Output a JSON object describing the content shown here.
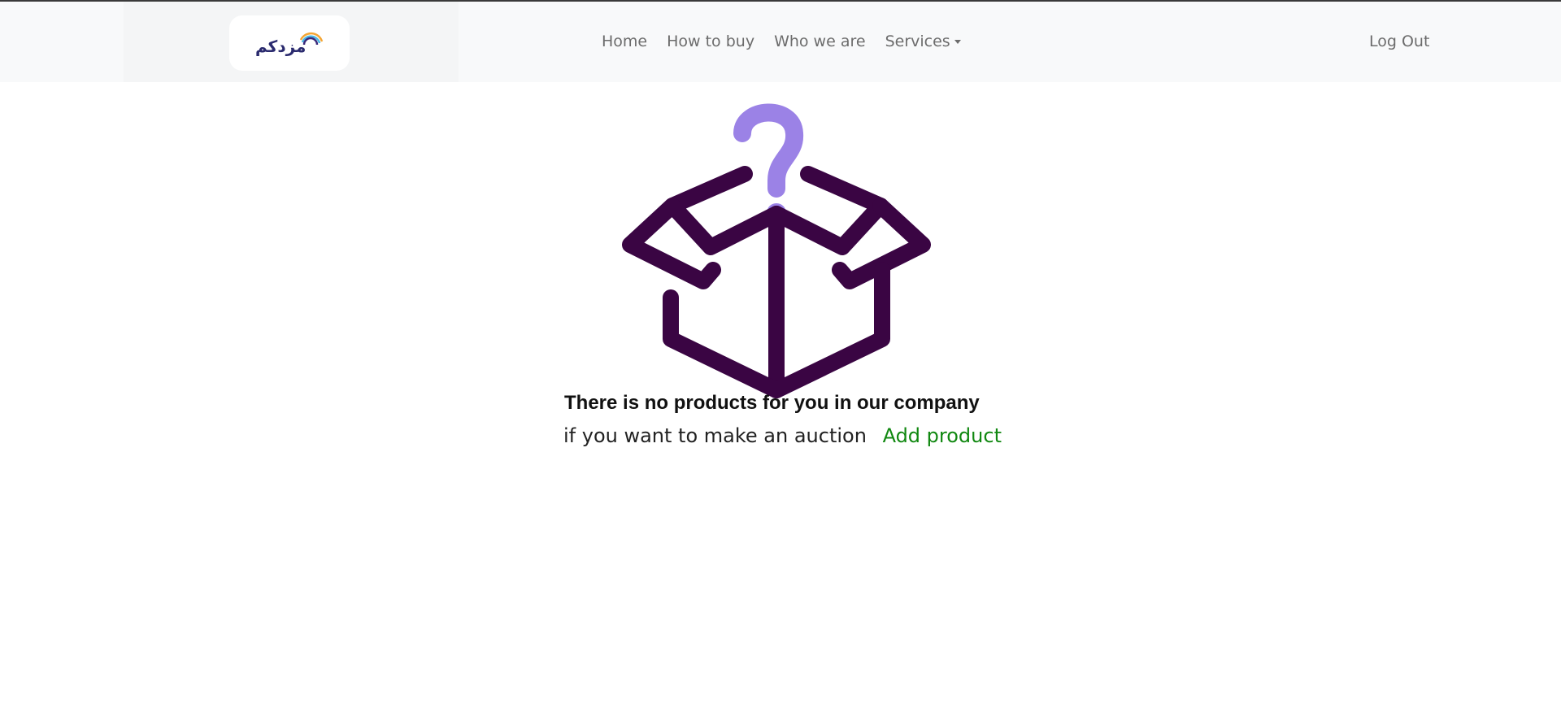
{
  "header": {
    "logo": {
      "alt": "Murdekum logo",
      "text": "مزدكم"
    },
    "nav": [
      {
        "label": "Home"
      },
      {
        "label": "How to buy"
      },
      {
        "label": "Who we are"
      },
      {
        "label": "Services",
        "has_dropdown": true
      }
    ],
    "logout_label": "Log Out"
  },
  "empty_state": {
    "illustration_icon": "open-box-question-icon",
    "title": "There is no products for you in our company",
    "prompt": "if you want to make an auction",
    "link_label": "Add product"
  },
  "colors": {
    "navbar_bg": "#f8f9fa",
    "nav_text": "#6c6c6c",
    "box_stroke": "#3a0543",
    "question_mark": "#9b82e6",
    "link_green": "#118811"
  }
}
